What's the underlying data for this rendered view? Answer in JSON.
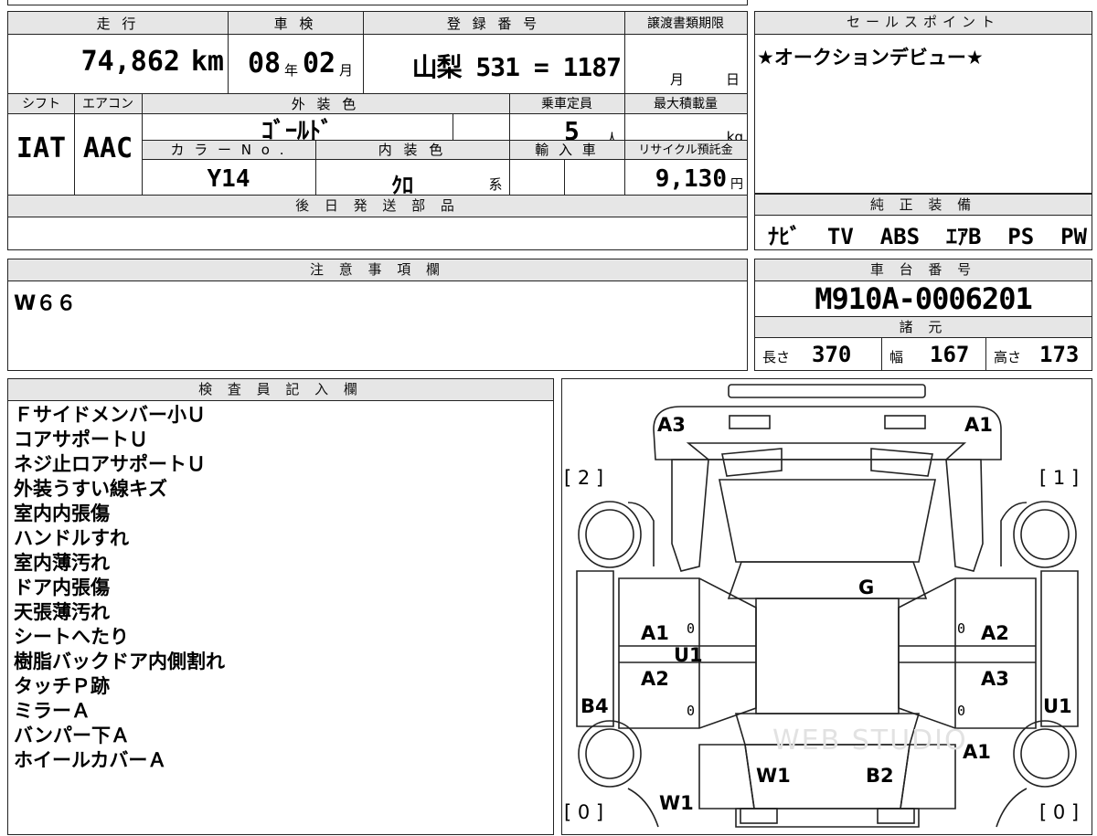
{
  "top": {
    "mileage_label": "走 行",
    "mileage_value": "74,862",
    "mileage_unit": "km",
    "inspection_label": "車 検",
    "inspection_year": "08",
    "inspection_year_unit": "年",
    "inspection_month": "02",
    "inspection_month_unit": "月",
    "reg_label": "登 録 番 号",
    "reg_value": "山梨 531 = 1187",
    "transfer_label": "譲渡書類期限",
    "transfer_month_unit": "月",
    "transfer_day_unit": "日",
    "sales_point_label": "セールスポイント",
    "sales_point_text": "★オークションデビュー★"
  },
  "row2": {
    "shift_label": "シフト",
    "shift_value": "IAT",
    "ac_label": "エアコン",
    "ac_value": "AAC",
    "ext_color_label": "外 装 色",
    "ext_color_value": "ｺﾞｰﾙﾄﾞ",
    "capacity_label": "乗車定員",
    "capacity_value": "5",
    "capacity_unit": "人",
    "max_load_label": "最大積載量",
    "max_load_unit": "kg",
    "color_no_label": "カ ラ ー N o .",
    "color_no_value": "Y14",
    "int_color_label": "内 装 色",
    "int_color_value": "ｸﾛ",
    "int_color_suffix": "系",
    "import_label": "輸 入 車",
    "recycle_label": "リサイクル預託金",
    "recycle_value": "9,130",
    "recycle_unit": "円"
  },
  "later_parts": {
    "label": "後 日 発 送 部 品"
  },
  "equipment": {
    "label": "純 正 装 備",
    "value": "ﾅﾋﾞ  TV  ABS  ｴｱB  PS  PW"
  },
  "notes": {
    "label": "注 意 事 項 欄",
    "value": "W６６"
  },
  "chassis": {
    "label": "車 台 番 号",
    "value": "M910A-0006201",
    "spec_label": "諸 元",
    "length_label": "長さ",
    "length_value": "370",
    "width_label": "幅",
    "width_value": "167",
    "height_label": "高さ",
    "height_value": "173"
  },
  "inspector": {
    "label": "検 査 員 記 入 欄",
    "lines": [
      "Ｆサイドメンバー小Ｕ",
      "コアサポートＵ",
      "ネジ止ロアサポートＵ",
      "外装うすい線キズ",
      "室内内張傷",
      "ハンドルすれ",
      "室内薄汚れ",
      "ドア内張傷",
      "天張薄汚れ",
      "シートへたり",
      "樹脂バックドア内側割れ",
      "タッチＰ跡",
      "ミラーＡ",
      "バンパー下Ａ",
      "ホイールカバーＡ"
    ]
  },
  "diagram": {
    "a3_top": "A3",
    "a1_top": "A1",
    "bracket_2": "[ 2 ]",
    "bracket_1": "[ 1 ]",
    "bracket_0_left": "[ 0 ]",
    "bracket_0_right": "[ 0 ]",
    "g": "G",
    "a1_left": "A1",
    "u1_center": "U1",
    "a2_left": "A2",
    "b4": "B4",
    "a2_right": "A2",
    "a3_right": "A3",
    "u1_right": "U1",
    "a1_right": "A1",
    "w1_center": "W1",
    "b2": "B2",
    "w1_left": "W1",
    "zero": "0",
    "watermark": "WEB STUDIO"
  }
}
